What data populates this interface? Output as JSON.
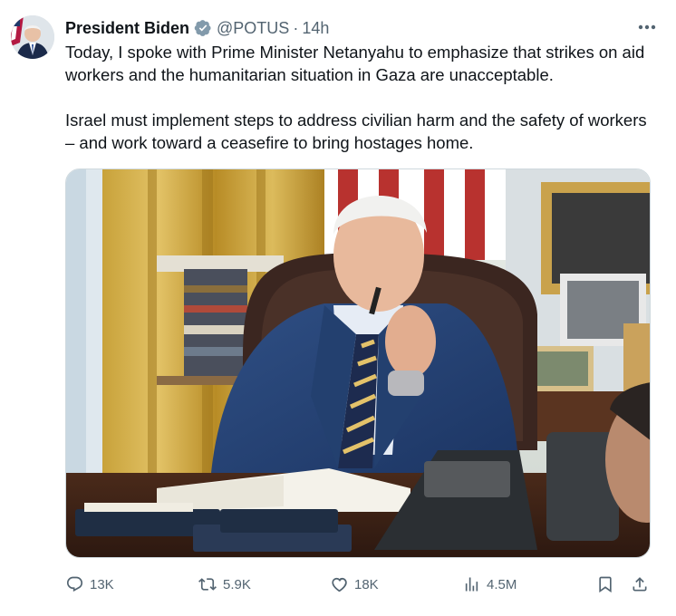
{
  "author": {
    "name": "President Biden",
    "handle": "@POTUS",
    "separator": "·",
    "time": "14h"
  },
  "tweet": {
    "paragraphs": [
      "Today, I spoke with Prime Minister Netanyahu to emphasize that strikes on aid workers and the humanitarian situation in Gaza are unacceptable.",
      "Israel must implement steps to address civilian harm and the safety of workers – and work toward a ceasefire to bring hostages home."
    ]
  },
  "actions": {
    "replies": "13K",
    "reposts": "5.9K",
    "likes": "18K",
    "views": "4.5M"
  },
  "icons": {
    "verified": "verified-badge-icon",
    "more": "more-icon",
    "reply": "reply-icon",
    "repost": "repost-icon",
    "like": "like-icon",
    "views": "views-icon",
    "bookmark": "bookmark-icon",
    "share": "share-icon"
  },
  "colors": {
    "text": "#0f1419",
    "secondary": "#536471",
    "verified_badge": "#829aab"
  }
}
